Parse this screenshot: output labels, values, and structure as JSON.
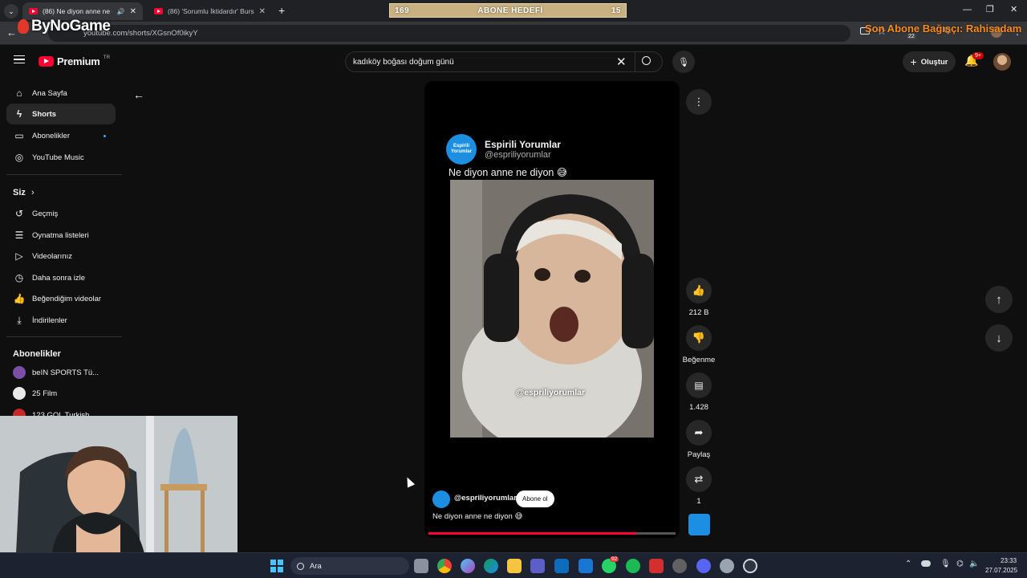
{
  "browser": {
    "tabs": [
      {
        "title": "(86) Ne diyon anne ne diyon",
        "active": true
      },
      {
        "title": "(86) 'Sorumlu İktidardır' Bursa",
        "active": false
      }
    ],
    "url": "youtube.com/shorts/XGsnOf0ikyY"
  },
  "overlay": {
    "brand": "ByNoGame",
    "goal_left": "169",
    "goal_label": "ABONE HEDEFİ",
    "goal_right": "15",
    "last_donor": "Son Abone Bağışçı: Rahisadam",
    "notif_badge": "22"
  },
  "header": {
    "logo_text": "Premium",
    "region": "TR",
    "search_value": "kadıköy boğası doğum günü",
    "create_label": "Oluştur",
    "notif_count": "9+"
  },
  "sidebar": {
    "main": [
      {
        "label": "Ana Sayfa",
        "icon": "home-icon"
      },
      {
        "label": "Shorts",
        "icon": "shorts-icon",
        "active": true
      },
      {
        "label": "Abonelikler",
        "icon": "subscriptions-icon"
      },
      {
        "label": "YouTube Music",
        "icon": "music-icon"
      }
    ],
    "you_heading": "Siz",
    "you": [
      {
        "label": "Geçmiş",
        "icon": "history-icon"
      },
      {
        "label": "Oynatma listeleri",
        "icon": "playlist-icon"
      },
      {
        "label": "Videolarınız",
        "icon": "your-videos-icon"
      },
      {
        "label": "Daha sonra izle",
        "icon": "watch-later-icon"
      },
      {
        "label": "Beğendiğim videolar",
        "icon": "liked-icon"
      },
      {
        "label": "İndirilenler",
        "icon": "download-icon"
      }
    ],
    "subs_heading": "Abonelikler",
    "subs": [
      {
        "label": "beIN SPORTS Tü...",
        "color": "#7b4ea8"
      },
      {
        "label": "25 Film",
        "color": "#e9e9e9"
      },
      {
        "label": "123 GOL Turkish",
        "color": "#c62828"
      }
    ]
  },
  "short": {
    "tweet_name": "Espirili Yorumlar",
    "tweet_handle": "@espriliyorumlar",
    "tweet_avatar_text": "Espirili Yorumlar",
    "tweet_text": "Ne diyon anne ne diyon 😅",
    "watermark": "@espriliyorumlar",
    "channel": "@espriliyorumlar",
    "subscribe_label": "Abone ol",
    "caption": "Ne diyon anne ne diyon 😅",
    "progress": 0.84
  },
  "actions": {
    "likes": "212 B",
    "dislike_label": "Beğenme",
    "comments": "1.428",
    "share_label": "Paylaş",
    "remix_count": "1"
  },
  "taskbar": {
    "search_label": "Ara",
    "time": "23:33",
    "date": "27.07.2025",
    "whatsapp_badge": "92"
  }
}
